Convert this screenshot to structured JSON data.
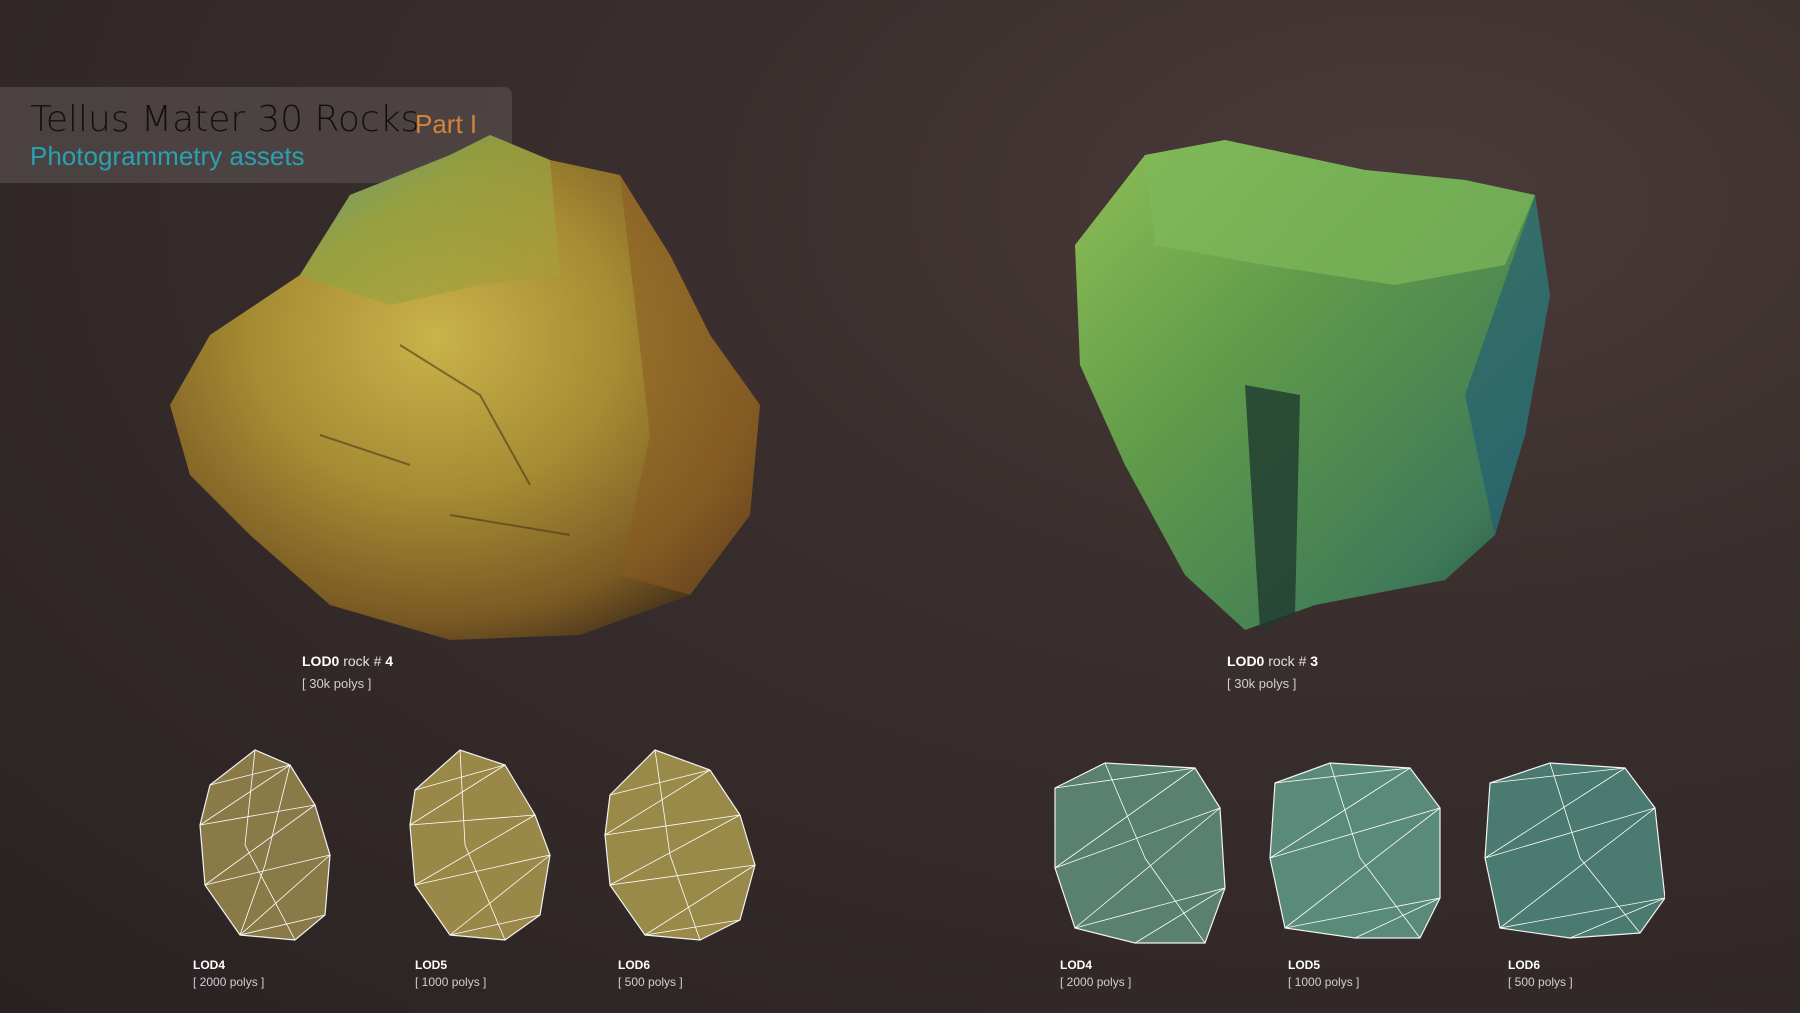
{
  "header": {
    "title": "Tellus Mater",
    "title_big": "30 Rocks",
    "part": "Part I",
    "subtitle": "Photogrammetry assets"
  },
  "left": {
    "lod0": {
      "prefix": "LOD0",
      "mid": " rock # ",
      "num": "4",
      "polys": "[ 30k polys ]"
    },
    "lods": [
      {
        "label": "LOD4",
        "polys": "[ 2000 polys ]"
      },
      {
        "label": "LOD5",
        "polys": "[ 1000 polys ]"
      },
      {
        "label": "LOD6",
        "polys": "[ 500 polys ]"
      }
    ]
  },
  "right": {
    "lod0": {
      "prefix": "LOD0",
      "mid": " rock # ",
      "num": "3",
      "polys": "[ 30k polys ]"
    },
    "lods": [
      {
        "label": "LOD4",
        "polys": "[ 2000 polys ]"
      },
      {
        "label": "LOD5",
        "polys": "[ 1000 polys ]"
      },
      {
        "label": "LOD6",
        "polys": "[ 500 polys ]"
      }
    ]
  },
  "colors": {
    "accent_orange": "#d1843a",
    "accent_teal": "#2aa1b2"
  }
}
